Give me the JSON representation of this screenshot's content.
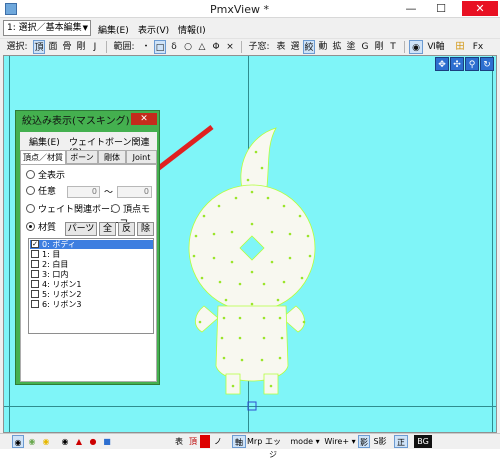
{
  "window": {
    "title": "PmxView *",
    "controls": {
      "minimize": "—",
      "maximize": "☐",
      "close": "✕"
    }
  },
  "menubar": {
    "mode_select_value": "1: 選択／基本編集",
    "items": [
      "編集(E)",
      "表示(V)",
      "情報(I)"
    ]
  },
  "toolbar": {
    "select_label": "選択:",
    "select_items": [
      "頂",
      "面",
      "骨",
      "剛",
      "J"
    ],
    "range_label": "範囲:",
    "range_items": [
      "・",
      "□",
      "δ",
      "○",
      "△",
      "Φ",
      "×"
    ],
    "subset_label": "子窓:",
    "subset_items": [
      "表",
      "選",
      "絞",
      "動",
      "拡",
      "塗",
      "G",
      "剛",
      "T"
    ],
    "right_items": [
      "◉",
      "Ⅵ軸",
      "田",
      "Fx"
    ]
  },
  "viewport": {
    "bg_color": "#7ff5f8",
    "model_color": "#f8f8f0",
    "vertex_color": "#b4ff3c",
    "nav_icons": [
      "rotate-icon",
      "move-icon",
      "zoom-icon",
      "reset-icon"
    ]
  },
  "dialog": {
    "title": "絞込み表示(マスキング)",
    "close": "✕",
    "menu": [
      "編集(E)",
      "ウェイトボーン関連(B)"
    ],
    "tabs": [
      "頂点／材質",
      "ボーン",
      "剛体",
      "Joint"
    ],
    "radios": [
      "全表示",
      "任意",
      "ウェイト関連ボーン",
      "頂点モーフ",
      "材質"
    ],
    "range_from": "0",
    "range_tilde": "〜",
    "range_to": "0",
    "buttons": [
      "パーツ",
      "全",
      "反",
      "除"
    ],
    "materials": [
      {
        "label": "0: ボディ",
        "checked": true,
        "selected": true
      },
      {
        "label": "1: 目",
        "checked": false,
        "selected": false
      },
      {
        "label": "2: 白目",
        "checked": false,
        "selected": false
      },
      {
        "label": "3: 口内",
        "checked": false,
        "selected": false
      },
      {
        "label": "4: リボン1",
        "checked": false,
        "selected": false
      },
      {
        "label": "5: リボン2",
        "checked": false,
        "selected": false
      },
      {
        "label": "6: リボン3",
        "checked": false,
        "selected": false
      }
    ]
  },
  "statusbar": {
    "items": [
      "表",
      "頂",
      "ノ",
      "軸",
      "Mrp",
      "エッジ",
      "mode ▾",
      "Wire+ ▾",
      "影",
      "S影",
      "正",
      "BG"
    ]
  },
  "colors": {
    "arrow": "#e02020",
    "dialog_frame": "#44b04f",
    "selection": "#3d7ee0"
  }
}
